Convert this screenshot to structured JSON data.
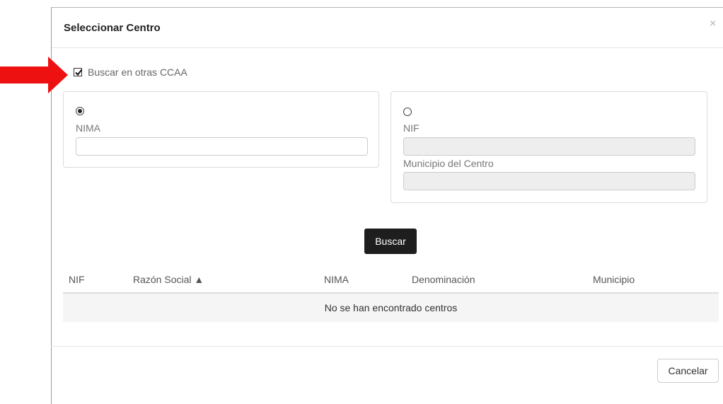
{
  "dialog": {
    "title": "Seleccionar Centro",
    "close_glyph": "×"
  },
  "annotation": {
    "icon": "red-arrow-icon",
    "color": "#ee1111"
  },
  "search_other_ccaa": {
    "label": "Buscar en otras CCAA",
    "checked": true
  },
  "nima_panel": {
    "selected": true,
    "field_label": "NIMA",
    "value": ""
  },
  "nif_panel": {
    "selected": false,
    "nif_label": "NIF",
    "nif_value": "",
    "municipio_label": "Municipio del Centro",
    "municipio_value": ""
  },
  "search_button": {
    "label": "Buscar"
  },
  "results_table": {
    "columns": [
      "NIF",
      "Razón Social ▲",
      "NIMA",
      "Denominación",
      "Municipio"
    ],
    "empty_message": "No se han encontrado centros"
  },
  "footer": {
    "cancel_label": "Cancelar"
  }
}
